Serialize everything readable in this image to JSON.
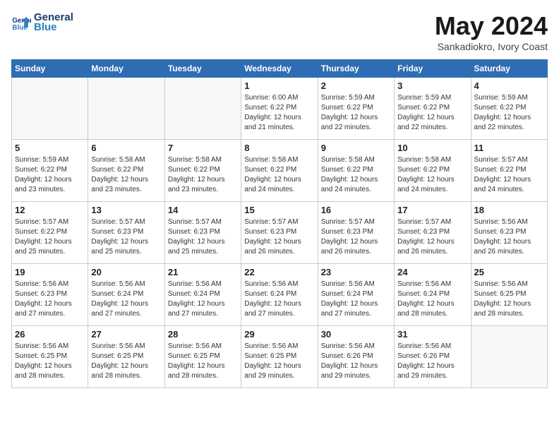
{
  "logo": {
    "line1": "General",
    "line2": "Blue"
  },
  "title": "May 2024",
  "subtitle": "Sankadiokro, Ivory Coast",
  "days_header": [
    "Sunday",
    "Monday",
    "Tuesday",
    "Wednesday",
    "Thursday",
    "Friday",
    "Saturday"
  ],
  "weeks": [
    [
      {
        "day": "",
        "info": ""
      },
      {
        "day": "",
        "info": ""
      },
      {
        "day": "",
        "info": ""
      },
      {
        "day": "1",
        "info": "Sunrise: 6:00 AM\nSunset: 6:22 PM\nDaylight: 12 hours\nand 21 minutes."
      },
      {
        "day": "2",
        "info": "Sunrise: 5:59 AM\nSunset: 6:22 PM\nDaylight: 12 hours\nand 22 minutes."
      },
      {
        "day": "3",
        "info": "Sunrise: 5:59 AM\nSunset: 6:22 PM\nDaylight: 12 hours\nand 22 minutes."
      },
      {
        "day": "4",
        "info": "Sunrise: 5:59 AM\nSunset: 6:22 PM\nDaylight: 12 hours\nand 22 minutes."
      }
    ],
    [
      {
        "day": "5",
        "info": "Sunrise: 5:59 AM\nSunset: 6:22 PM\nDaylight: 12 hours\nand 23 minutes."
      },
      {
        "day": "6",
        "info": "Sunrise: 5:58 AM\nSunset: 6:22 PM\nDaylight: 12 hours\nand 23 minutes."
      },
      {
        "day": "7",
        "info": "Sunrise: 5:58 AM\nSunset: 6:22 PM\nDaylight: 12 hours\nand 23 minutes."
      },
      {
        "day": "8",
        "info": "Sunrise: 5:58 AM\nSunset: 6:22 PM\nDaylight: 12 hours\nand 24 minutes."
      },
      {
        "day": "9",
        "info": "Sunrise: 5:58 AM\nSunset: 6:22 PM\nDaylight: 12 hours\nand 24 minutes."
      },
      {
        "day": "10",
        "info": "Sunrise: 5:58 AM\nSunset: 6:22 PM\nDaylight: 12 hours\nand 24 minutes."
      },
      {
        "day": "11",
        "info": "Sunrise: 5:57 AM\nSunset: 6:22 PM\nDaylight: 12 hours\nand 24 minutes."
      }
    ],
    [
      {
        "day": "12",
        "info": "Sunrise: 5:57 AM\nSunset: 6:22 PM\nDaylight: 12 hours\nand 25 minutes."
      },
      {
        "day": "13",
        "info": "Sunrise: 5:57 AM\nSunset: 6:23 PM\nDaylight: 12 hours\nand 25 minutes."
      },
      {
        "day": "14",
        "info": "Sunrise: 5:57 AM\nSunset: 6:23 PM\nDaylight: 12 hours\nand 25 minutes."
      },
      {
        "day": "15",
        "info": "Sunrise: 5:57 AM\nSunset: 6:23 PM\nDaylight: 12 hours\nand 26 minutes."
      },
      {
        "day": "16",
        "info": "Sunrise: 5:57 AM\nSunset: 6:23 PM\nDaylight: 12 hours\nand 26 minutes."
      },
      {
        "day": "17",
        "info": "Sunrise: 5:57 AM\nSunset: 6:23 PM\nDaylight: 12 hours\nand 26 minutes."
      },
      {
        "day": "18",
        "info": "Sunrise: 5:56 AM\nSunset: 6:23 PM\nDaylight: 12 hours\nand 26 minutes."
      }
    ],
    [
      {
        "day": "19",
        "info": "Sunrise: 5:56 AM\nSunset: 6:23 PM\nDaylight: 12 hours\nand 27 minutes."
      },
      {
        "day": "20",
        "info": "Sunrise: 5:56 AM\nSunset: 6:24 PM\nDaylight: 12 hours\nand 27 minutes."
      },
      {
        "day": "21",
        "info": "Sunrise: 5:56 AM\nSunset: 6:24 PM\nDaylight: 12 hours\nand 27 minutes."
      },
      {
        "day": "22",
        "info": "Sunrise: 5:56 AM\nSunset: 6:24 PM\nDaylight: 12 hours\nand 27 minutes."
      },
      {
        "day": "23",
        "info": "Sunrise: 5:56 AM\nSunset: 6:24 PM\nDaylight: 12 hours\nand 27 minutes."
      },
      {
        "day": "24",
        "info": "Sunrise: 5:56 AM\nSunset: 6:24 PM\nDaylight: 12 hours\nand 28 minutes."
      },
      {
        "day": "25",
        "info": "Sunrise: 5:56 AM\nSunset: 6:25 PM\nDaylight: 12 hours\nand 28 minutes."
      }
    ],
    [
      {
        "day": "26",
        "info": "Sunrise: 5:56 AM\nSunset: 6:25 PM\nDaylight: 12 hours\nand 28 minutes."
      },
      {
        "day": "27",
        "info": "Sunrise: 5:56 AM\nSunset: 6:25 PM\nDaylight: 12 hours\nand 28 minutes."
      },
      {
        "day": "28",
        "info": "Sunrise: 5:56 AM\nSunset: 6:25 PM\nDaylight: 12 hours\nand 28 minutes."
      },
      {
        "day": "29",
        "info": "Sunrise: 5:56 AM\nSunset: 6:25 PM\nDaylight: 12 hours\nand 29 minutes."
      },
      {
        "day": "30",
        "info": "Sunrise: 5:56 AM\nSunset: 6:26 PM\nDaylight: 12 hours\nand 29 minutes."
      },
      {
        "day": "31",
        "info": "Sunrise: 5:56 AM\nSunset: 6:26 PM\nDaylight: 12 hours\nand 29 minutes."
      },
      {
        "day": "",
        "info": ""
      }
    ]
  ]
}
